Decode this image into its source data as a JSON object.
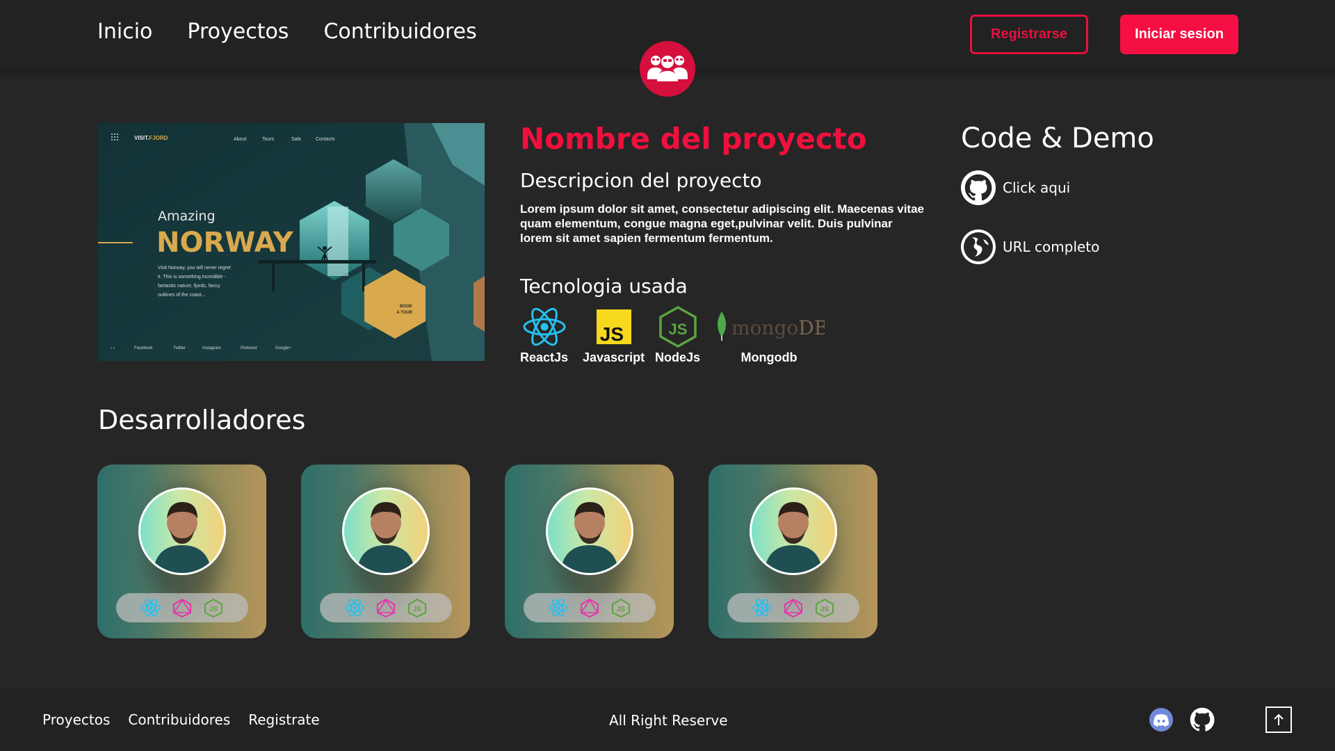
{
  "header": {
    "nav": [
      "Inicio",
      "Proyectos",
      "Contribuidores"
    ],
    "register_label": "Registrarse",
    "login_label": "Iniciar sesion",
    "brand_color": "#f50f43"
  },
  "project": {
    "image": {
      "brand_prefix": "VISIT.",
      "brand_suffix": "FJORD",
      "nav": [
        "About",
        "Tours",
        "Sale",
        "Contacts"
      ],
      "amazing": "Amazing",
      "headline": "NORWAY",
      "blurb": [
        "Visit Norway, you will never regret",
        "it. This is something incredible -",
        "fantastic nature, fjords, fancy",
        "outlines of the coast..."
      ],
      "cta_line1": "BOOK",
      "cta_line2": "A TOUR",
      "social": [
        "Facebook",
        "Twitter",
        "Instagram",
        "Pinterest",
        "Google+"
      ]
    },
    "title": "Nombre del proyecto",
    "description_title": "Descripcion del proyecto",
    "description": "Lorem ipsum dolor sit amet, consectetur adipiscing elit. Maecenas vitae quam elementum, congue magna eget,pulvinar velit. Duis  pulvinar lorem sit amet sapien fermentum fermentum.",
    "tech_title": "Tecnologia usada",
    "technologies": [
      {
        "label": "ReactJs",
        "icon": "react-icon"
      },
      {
        "label": "Javascript",
        "icon": "javascript-icon"
      },
      {
        "label": "NodeJs",
        "icon": "nodejs-icon"
      },
      {
        "label": "Mongodb",
        "icon": "mongodb-icon",
        "logo_text_a": "mongo",
        "logo_text_b": "DB"
      }
    ]
  },
  "code_demo": {
    "title": "Code & Demo",
    "links": [
      {
        "label": "Click aqui",
        "icon": "github-icon"
      },
      {
        "label": "URL completo",
        "icon": "globe-icon"
      }
    ]
  },
  "developers": {
    "title": "Desarrolladores",
    "cards": [
      {
        "stack": [
          "react-icon",
          "graphql-icon",
          "nodejs-icon"
        ]
      },
      {
        "stack": [
          "react-icon",
          "graphql-icon",
          "nodejs-icon"
        ]
      },
      {
        "stack": [
          "react-icon",
          "graphql-icon",
          "nodejs-icon"
        ]
      },
      {
        "stack": [
          "react-icon",
          "graphql-icon",
          "nodejs-icon"
        ]
      }
    ]
  },
  "footer": {
    "links": [
      "Proyectos",
      "Contribuidores",
      "Registrate"
    ],
    "copyright": "All Right Reserve",
    "icons": [
      "discord-icon",
      "github-icon",
      "arrow-up-icon"
    ]
  }
}
